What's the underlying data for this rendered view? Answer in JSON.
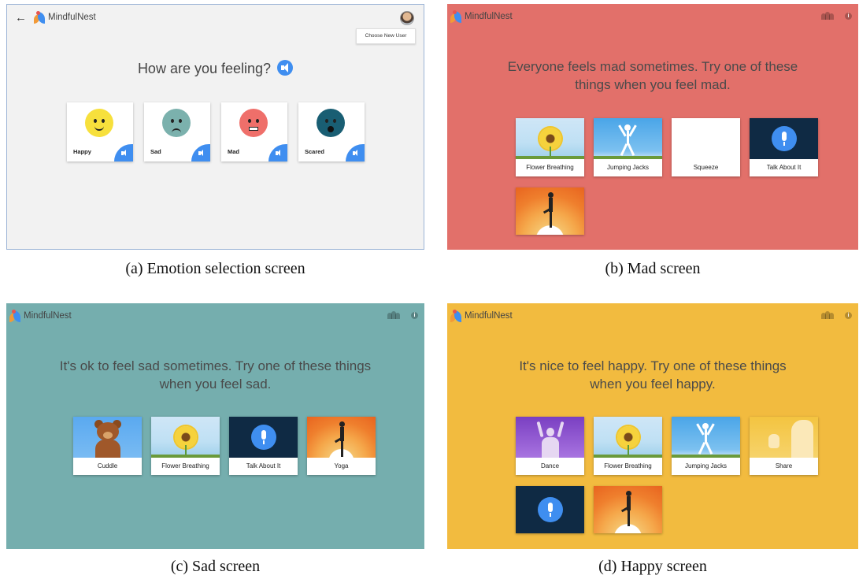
{
  "app_name": "MindfulNest",
  "panel_a": {
    "choose_user": "Choose New User",
    "question": "How are you feeling?",
    "emotions": [
      {
        "label": "Happy",
        "color": "#f7e03c"
      },
      {
        "label": "Sad",
        "color": "#7bb1ad"
      },
      {
        "label": "Mad",
        "color": "#ef6f6a"
      },
      {
        "label": "Scared",
        "color": "#195e73"
      }
    ],
    "caption": "(a) Emotion selection screen"
  },
  "panel_b": {
    "bg": "#e2706a",
    "prompt": "Everyone feels mad sometimes. Try one of these things when you feel mad.",
    "activities": [
      "Flower Breathing",
      "Jumping Jacks",
      "Squeeze",
      "Talk About It",
      ""
    ],
    "caption": "(b) Mad screen"
  },
  "panel_c": {
    "bg": "#75aeae",
    "prompt": "It's ok to feel sad sometimes. Try one of these things when you feel sad.",
    "activities": [
      "Cuddle",
      "Flower Breathing",
      "Talk About It",
      "Yoga"
    ],
    "caption": "(c) Sad screen"
  },
  "panel_d": {
    "bg": "#f2bb3f",
    "prompt": "It's nice to feel happy. Try one of these things when you feel happy.",
    "activities": [
      "Dance",
      "Flower Breathing",
      "Jumping Jacks",
      "Share",
      "",
      ""
    ],
    "caption": "(d) Happy screen"
  }
}
